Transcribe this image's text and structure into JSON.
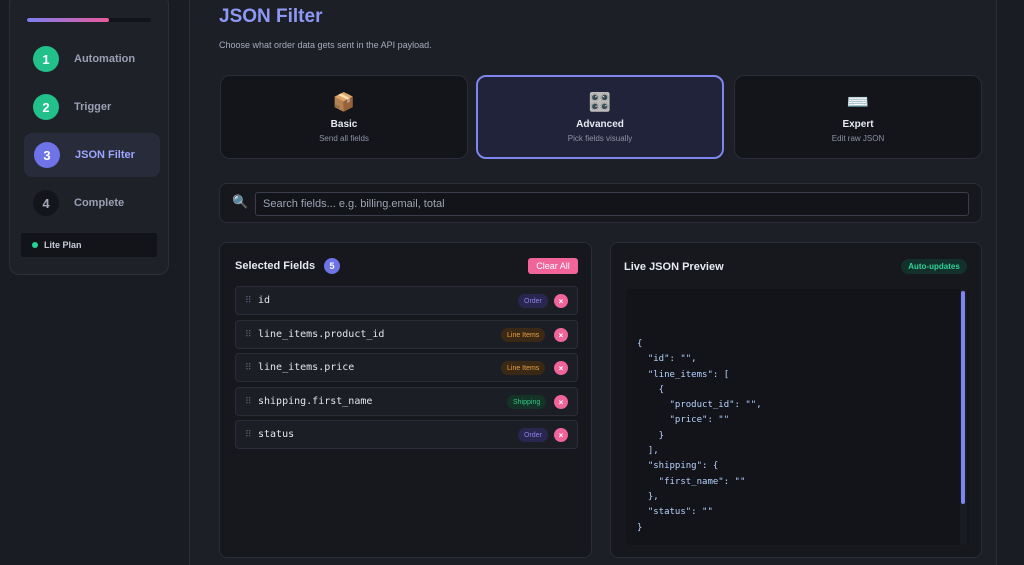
{
  "sidebar": {
    "progress_percent": 66,
    "steps": [
      {
        "num": "1",
        "label": "Automation"
      },
      {
        "num": "2",
        "label": "Trigger"
      },
      {
        "num": "3",
        "label": "JSON Filter"
      },
      {
        "num": "4",
        "label": "Complete"
      }
    ],
    "plan_label": "Lite Plan"
  },
  "header": {
    "title": "JSON Filter",
    "subtitle": "Choose what order data gets sent in the API payload."
  },
  "modes": [
    {
      "icon": "📦",
      "title": "Basic",
      "desc": "Send all fields"
    },
    {
      "icon": "🎛️",
      "title": "Advanced",
      "desc": "Pick fields visually"
    },
    {
      "icon": "⌨️",
      "title": "Expert",
      "desc": "Edit raw JSON"
    }
  ],
  "search": {
    "icon": "🔍",
    "placeholder": "Search fields... e.g. billing.email, total",
    "value": ""
  },
  "selected": {
    "title": "Selected Fields",
    "count": "5",
    "clear_label": "Clear All",
    "fields": [
      {
        "name": "id",
        "tag": "Order"
      },
      {
        "name": "line_items.product_id",
        "tag": "Line Items"
      },
      {
        "name": "line_items.price",
        "tag": "Line Items"
      },
      {
        "name": "shipping.first_name",
        "tag": "Shipping"
      },
      {
        "name": "status",
        "tag": "Order"
      }
    ],
    "remove_glyph": "×",
    "handle_glyph": "⠿"
  },
  "preview": {
    "title": "Live JSON Preview",
    "badge": "Auto-updates",
    "code": "{\n  \"id\": \"\",\n  \"line_items\": [\n    {\n      \"product_id\": \"\",\n      \"price\": \"\"\n    }\n  ],\n  \"shipping\": {\n    \"first_name\": \"\"\n  },\n  \"status\": \"\"\n}"
  },
  "colors": {
    "accent": "#6e73e8",
    "done": "#22c08a",
    "danger": "#f0649a"
  }
}
